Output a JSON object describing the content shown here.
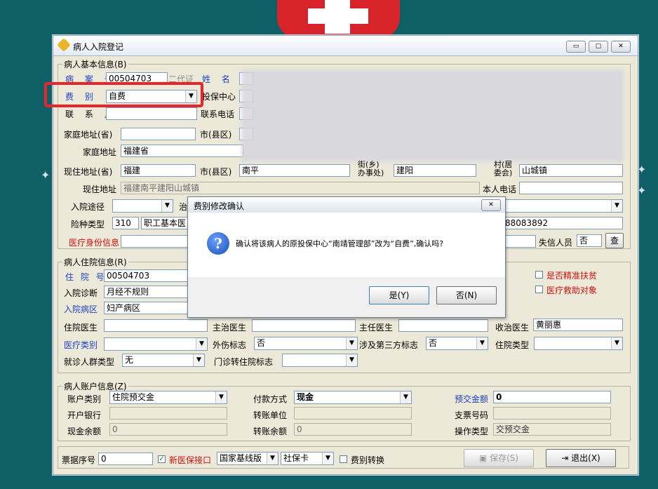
{
  "window": {
    "title": "病人入院登记",
    "controls": {
      "minimize": "▭",
      "restore": "▢",
      "close": "✕"
    }
  },
  "basic": {
    "legend": "病人基本信息(B)",
    "case_no_label": "病 案 号",
    "case_no": "00504703",
    "id2_label": "二代证",
    "name_label": "姓 名",
    "fee_type_label": "费 别",
    "fee_type": "自费",
    "insurance_center_label": "投保中心",
    "contact_label": "联 系 人",
    "contact_phone_label": "联系电话",
    "home_province_label": "家庭地址(省)",
    "home_county_label": "市(县区)",
    "home_address_label": "家庭地址",
    "home_address": "福建省",
    "cur_province_label": "现住地址(省)",
    "cur_province": "福建",
    "cur_county_label": "市(县区)",
    "cur_county": "南平",
    "office_label_a": "街(乡)",
    "office_label_b": "办事处)",
    "office_value": "建阳",
    "committee_label_a": "村(居",
    "committee_label_b": "委会)",
    "committee_value": "山城镇",
    "cur_address_label": "现住地址",
    "cur_address": "福建南平建阳山城镇",
    "own_phone_label": "本人电话",
    "admit_path_label": "入院途径",
    "treat_label": "治",
    "ins_type_label": "险种类型",
    "ins_type_code": "310",
    "ins_type_name": "职工基本医",
    "phone_partial": "88083892",
    "med_identity_label": "医疗身份信息",
    "unemployed_label": "失信人员",
    "unemployed_value": "否",
    "query_button": "查"
  },
  "stay": {
    "legend": "病人住院信息(R)",
    "inpatient_no_label": "住 院 号",
    "inpatient_no": "00504703",
    "diagnosis_label": "入院诊断",
    "diagnosis": "月经不规则",
    "ward_label": "入院病区",
    "ward": "妇产病区",
    "poverty_label": "是否精准扶贫",
    "aid_label": "医疗救助对象",
    "doctor_label": "住院医生",
    "attending_label": "主治医生",
    "chief_label": "主任医生",
    "admitting_label": "收治医生",
    "admitting_value": "黄丽惠",
    "med_category_label": "医疗类别",
    "injury_label": "外伤标志",
    "injury_value": "否",
    "third_party_label": "涉及第三方标志",
    "third_party_value": "否",
    "stay_type_label": "住院类型",
    "visitor_type_label": "就诊人群类型",
    "visitor_type_value": "无",
    "outpatient_transfer_label": "门诊转住院标志"
  },
  "account": {
    "legend": "病人账户信息(Z)",
    "acct_type_label": "账户类别",
    "acct_type": "住院预交金",
    "pay_method_label": "付款方式",
    "pay_method": "现金",
    "prepay_label": "预交金额",
    "prepay": "0",
    "bank_label": "开户银行",
    "transfer_unit_label": "转账单位",
    "cheque_label": "支票号码",
    "cash_balance_label": "现金余额",
    "cash_balance": "0",
    "transfer_balance_label": "转账余额",
    "transfer_balance": "0",
    "op_type_label": "操作类型",
    "op_type": "交预交金"
  },
  "footer": {
    "ticket_label": "票据序号",
    "ticket_value": "0",
    "new_insurance_label": "新医保接口",
    "interface_value": "国家基线版",
    "card_value": "社保卡",
    "fee_transfer_label": "费别转换",
    "save_button": "保存(S)",
    "exit_button": "退出(X)"
  },
  "dialog": {
    "title": "费别修改确认",
    "icon": "?",
    "message": "确认将该病人的原投保中心“南靖管理部”改为“自费”,确认吗?",
    "yes_button": "是(Y)",
    "no_button": "否(N)"
  }
}
